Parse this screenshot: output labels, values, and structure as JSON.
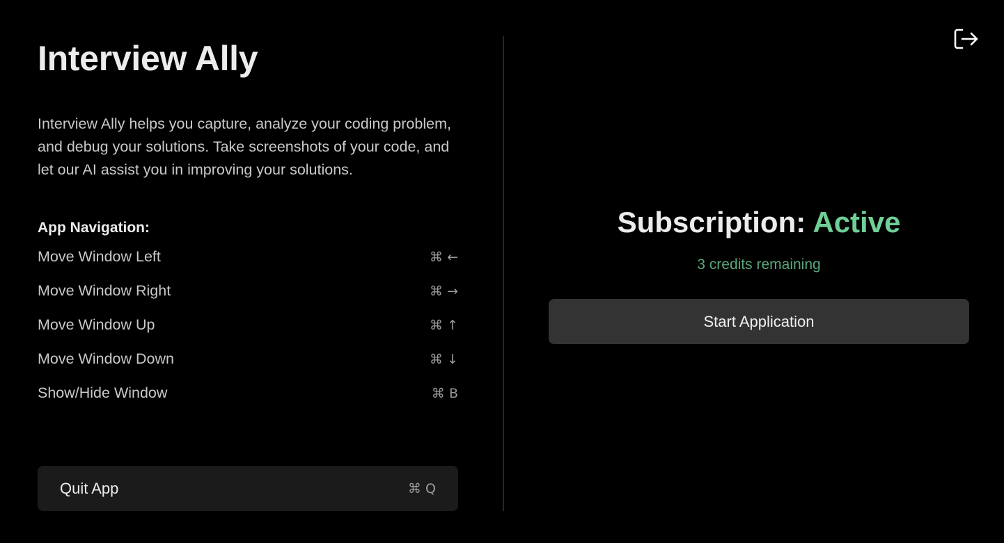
{
  "app": {
    "title": "Interview Ally",
    "description": "Interview Ally helps you capture, analyze your coding problem, and debug your solutions. Take screenshots of your code, and let our AI assist you in improving your solutions."
  },
  "navigation": {
    "heading": "App Navigation:",
    "shortcuts": [
      {
        "label": "Move Window Left",
        "keys": "⌘ ←"
      },
      {
        "label": "Move Window Right",
        "keys": "⌘ →"
      },
      {
        "label": "Move Window Up",
        "keys": "⌘ ↑"
      },
      {
        "label": "Move Window Down",
        "keys": "⌘ ↓"
      },
      {
        "label": "Show/Hide Window",
        "keys": "⌘ B"
      }
    ]
  },
  "quit": {
    "label": "Quit App",
    "keys": "⌘ Q"
  },
  "subscription": {
    "label": "Subscription:",
    "status": "Active",
    "credits": "3 credits remaining",
    "start_label": "Start Application"
  },
  "icons": {
    "logout": "logout-icon"
  },
  "colors": {
    "background": "#000000",
    "active_status": "#6fcf97",
    "credits": "#5aa87b",
    "start_button": "#333333",
    "quit_button": "#1b1b1b"
  }
}
